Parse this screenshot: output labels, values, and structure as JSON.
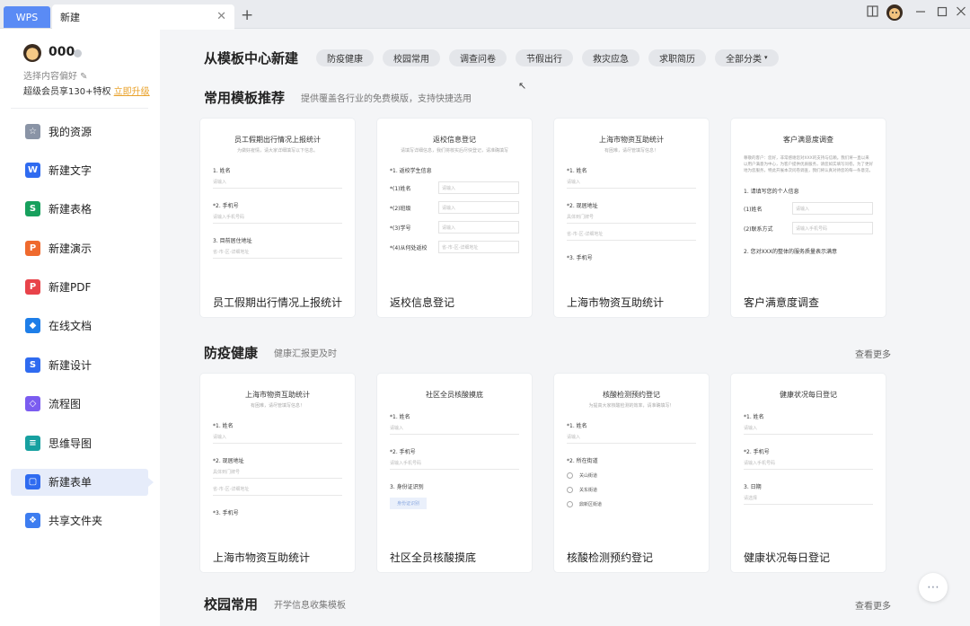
{
  "topbar": {
    "wps_label": "WPS",
    "tab_label": "新建",
    "close_glyph": "✕",
    "add_glyph": "+"
  },
  "sidebar": {
    "username": "000",
    "preference": "选择内容偏好 ✎",
    "member_text": "超级会员享130+特权",
    "upgrade_label": "立即升级",
    "items": [
      {
        "label": "我的资源",
        "icon": "resources-icon",
        "color": "#8a94a6",
        "glyph": "☆"
      },
      {
        "label": "新建文字",
        "icon": "writer-icon",
        "color": "#2f6bf0",
        "glyph": "W"
      },
      {
        "label": "新建表格",
        "icon": "spreadsheet-icon",
        "color": "#17a05d",
        "glyph": "S"
      },
      {
        "label": "新建演示",
        "icon": "presentation-icon",
        "color": "#ef6a2e",
        "glyph": "P"
      },
      {
        "label": "新建PDF",
        "icon": "pdf-icon",
        "color": "#e8434a",
        "glyph": "P"
      },
      {
        "label": "在线文档",
        "icon": "online-doc-icon",
        "color": "#1e7ee8",
        "glyph": "◆"
      },
      {
        "label": "新建设计",
        "icon": "design-icon",
        "color": "#2f6bf0",
        "glyph": "S"
      },
      {
        "label": "流程图",
        "icon": "flowchart-icon",
        "color": "#7b5cf0",
        "glyph": "◇"
      },
      {
        "label": "思维导图",
        "icon": "mindmap-icon",
        "color": "#17a0a0",
        "glyph": "≡"
      },
      {
        "label": "新建表单",
        "icon": "form-icon",
        "color": "#2f6bf0",
        "glyph": "▢"
      },
      {
        "label": "共享文件夹",
        "icon": "shared-folder-icon",
        "color": "#3d7df0",
        "glyph": "❖"
      }
    ]
  },
  "main": {
    "header_title": "从模板中心新建",
    "categories": [
      "防疫健康",
      "校园常用",
      "调查问卷",
      "节假出行",
      "救灾应急",
      "求职简历",
      "全部分类"
    ],
    "caret": "▾",
    "sections": [
      {
        "title": "常用模板推荐",
        "subtitle": "提供覆盖各行业的免费模版，支持快捷选用",
        "more": "",
        "cards": [
          {
            "title": "员工假期出行情况上报统计",
            "pv_title": "员工假期出行情况上报统计",
            "pv_desc": "为做好疫情，请大家详细填写以下信息。"
          },
          {
            "title": "返校信息登记",
            "pv_title": "返校信息登记",
            "pv_desc": "请填写详细信息，我们将核实后尽快登记，请准确填写"
          },
          {
            "title": "上海市物资互助统计",
            "pv_title": "上海市物资互助统计",
            "pv_desc": "有困难，请尽管填写信息！"
          },
          {
            "title": "客户满意度调查",
            "pv_title": "客户满意度调查",
            "pv_desc": ""
          }
        ]
      },
      {
        "title": "防疫健康",
        "subtitle": "健康汇报更及时",
        "more": "查看更多",
        "cards": [
          {
            "title": "上海市物资互助统计",
            "pv_title": "上海市物资互助统计",
            "pv_desc": "有困难，请尽管填写信息！"
          },
          {
            "title": "社区全员核酸摸底",
            "pv_title": "社区全员核酸摸底",
            "pv_desc": ""
          },
          {
            "title": "核酸检测预约登记",
            "pv_title": "核酸检测预约登记",
            "pv_desc": "为提高大家核酸检测的效率，请准确填写！"
          },
          {
            "title": "健康状况每日登记",
            "pv_title": "健康状况每日登记",
            "pv_desc": ""
          }
        ]
      },
      {
        "title": "校园常用",
        "subtitle": "开学信息收集模板",
        "more": "查看更多",
        "cards": []
      }
    ],
    "preview": {
      "name": "1. 姓名",
      "name_req": "*1. 姓名",
      "phone": "2. 手机号",
      "phone_req": "*2. 手机号",
      "home_address": "3. 目前居住地址",
      "current_address": "*2. 现居地址",
      "address_hint": "具体到门牌号",
      "phone3": "*3. 手机号",
      "please_input": "请输入",
      "please_phone": "请输入手机号码",
      "region_hint": "省-市-区-详细地址",
      "student_info": "*1. 返校学生信息",
      "f_name": "*(1)姓名",
      "f_class": "*(2)班级",
      "f_id": "*(3)学号",
      "f_from": "*(4)从何处返校",
      "personal_info": "1. 请填写您的个人信息",
      "c_name": "(1)姓名",
      "c_contact": "(2)联系方式",
      "overall": "2. 您对XXX的整体的服务质量表示满意",
      "identity": "3. 身份证识别",
      "id_upload": "身份证识别",
      "district": "*2. 所在街道",
      "d1": "关山街道",
      "d2": "关东街道",
      "d3": "鼎新区街道",
      "date": "3. 日期",
      "pick_date": "请选择",
      "survey_para": "尊敬的客户：您好，非常感谢您对XXX的支持与信赖。我们将一直以来以用户满意为中心，为客户提供优质服务，请您如实填写问卷。为了更好地为您服务，特此开展本次问卷调查，我们将认真对待您的每一条意见。"
    }
  },
  "chat_glyph": "⋯",
  "cursor_glyph": "↖"
}
